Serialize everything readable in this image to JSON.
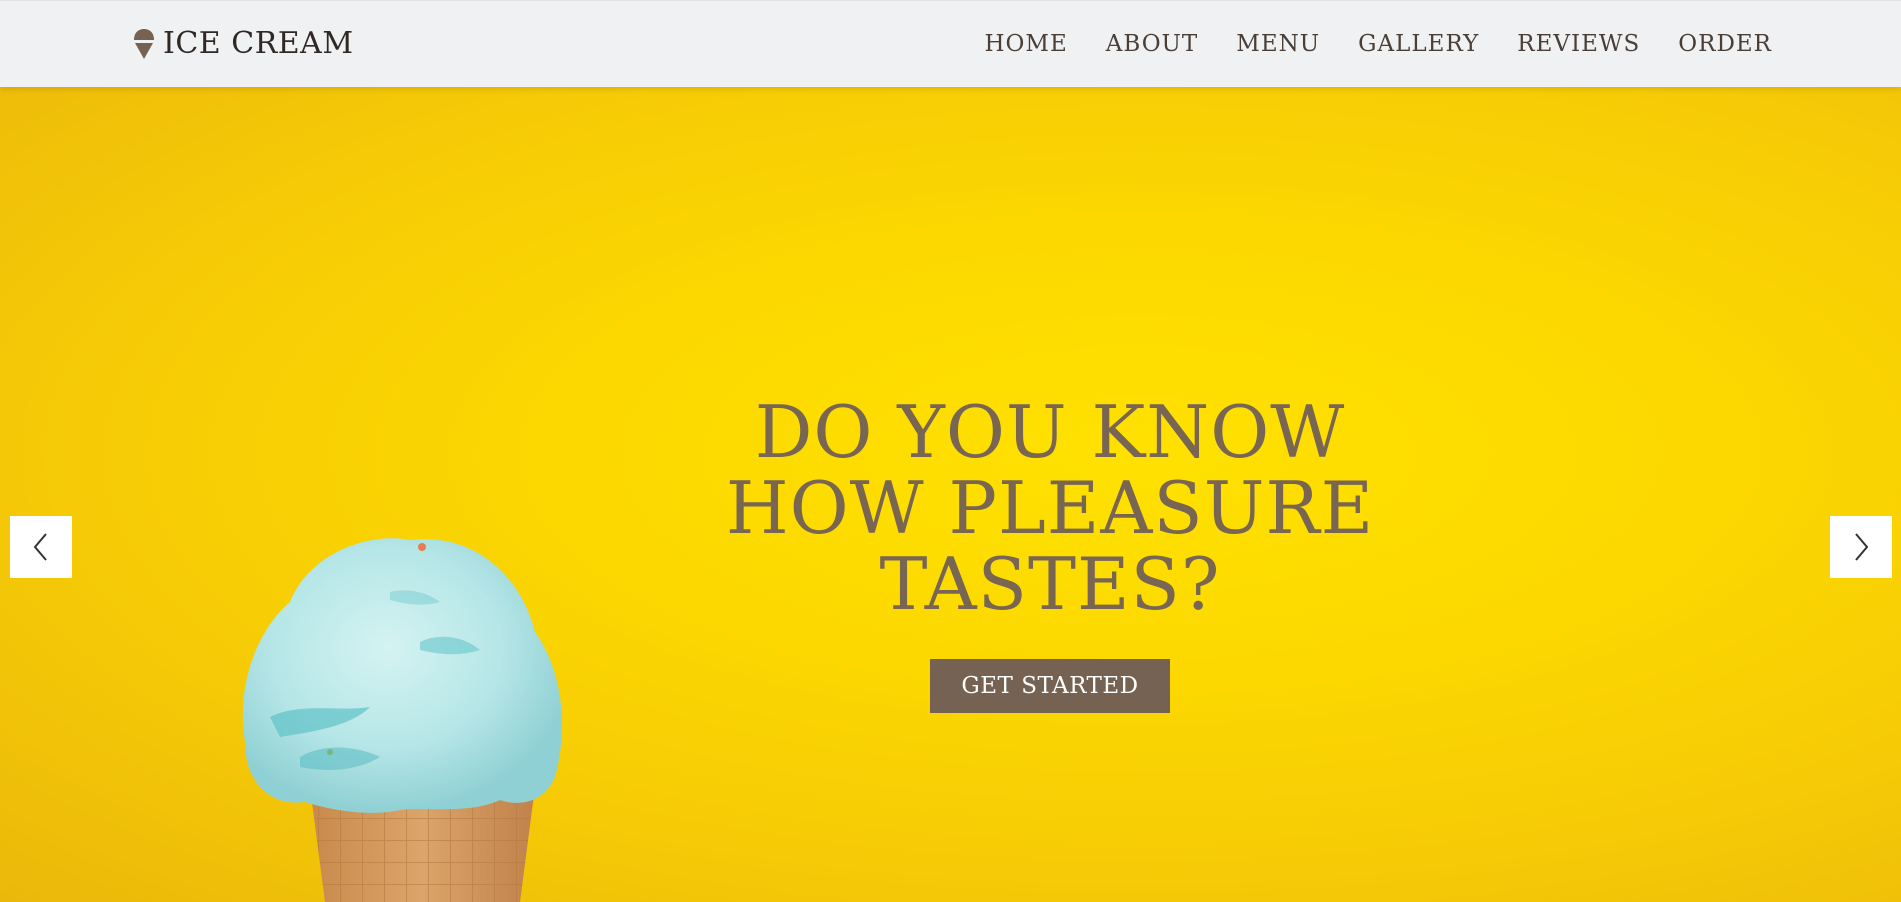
{
  "navbar": {
    "brand": {
      "icon": "ice-cream-icon",
      "text": "ICE CREAM"
    },
    "links": [
      {
        "label": "HOME"
      },
      {
        "label": "ABOUT"
      },
      {
        "label": "MENU"
      },
      {
        "label": "GALLERY"
      },
      {
        "label": "REVIEWS"
      },
      {
        "label": "ORDER"
      }
    ]
  },
  "hero": {
    "title_lines": [
      "DO YOU KNOW",
      "HOW PLEASURE",
      "TASTES?"
    ],
    "cta_label": "GET STARTED",
    "prev_icon": "chevron-left-icon",
    "next_icon": "chevron-right-icon"
  },
  "colors": {
    "navbar_bg": "#eff1f3",
    "hero_bg": "#fcd800",
    "title": "#786552",
    "button_bg": "#756252",
    "button_text": "#ffffff"
  }
}
